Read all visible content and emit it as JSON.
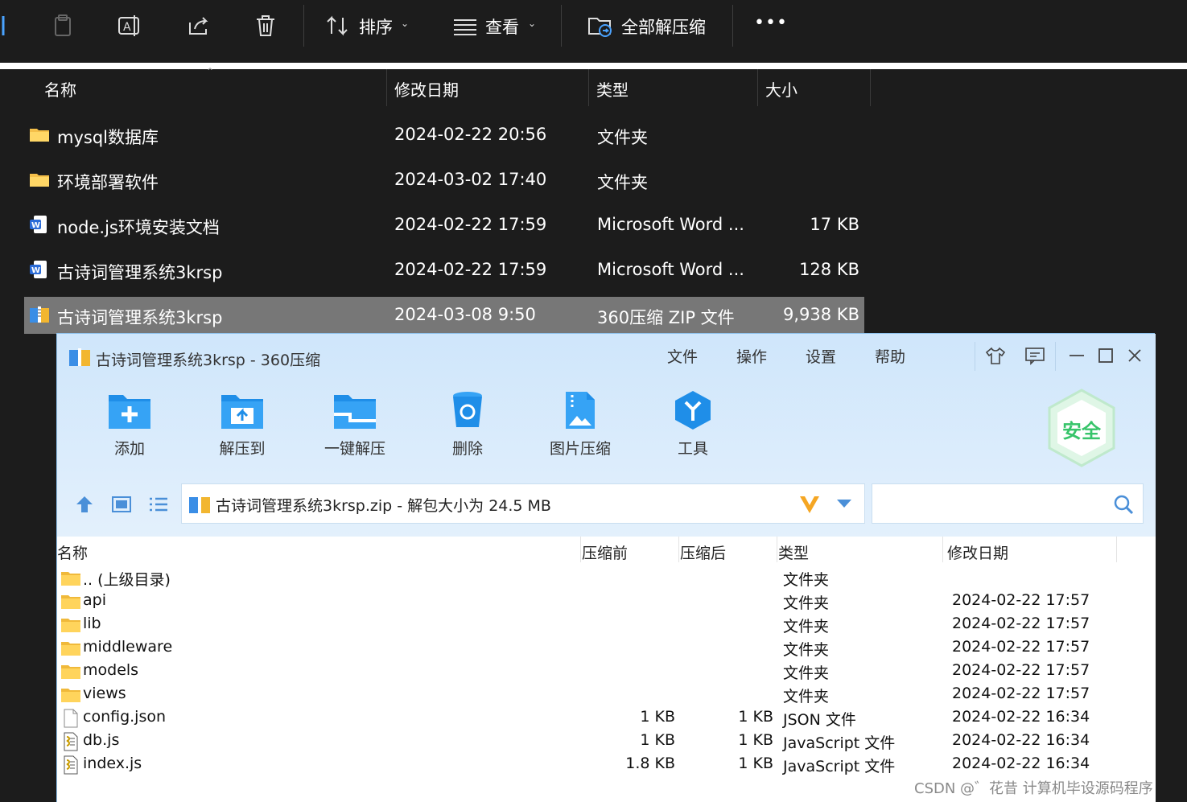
{
  "toolbar": {
    "sort_label": "排序",
    "view_label": "查看",
    "extract_all_label": "全部解压缩",
    "more_label": "•••"
  },
  "explorer": {
    "columns": {
      "name": "名称",
      "modified": "修改日期",
      "type": "类型",
      "size": "大小"
    },
    "rows": [
      {
        "name": "mysql数据库",
        "modified": "2024-02-22 20:56",
        "type": "文件夹",
        "size": "",
        "icon": "folder-icon"
      },
      {
        "name": "环境部署软件",
        "modified": "2024-03-02 17:40",
        "type": "文件夹",
        "size": "",
        "icon": "folder-icon"
      },
      {
        "name": "node.js环境安装文档",
        "modified": "2024-02-22 17:59",
        "type": "Microsoft Word ...",
        "size": "17 KB",
        "icon": "word-doc-icon"
      },
      {
        "name": "古诗词管理系统3krsp",
        "modified": "2024-02-22 17:59",
        "type": "Microsoft Word ...",
        "size": "128 KB",
        "icon": "word-doc-icon"
      },
      {
        "name": "古诗词管理系统3krsp",
        "modified": "2024-03-08 9:50",
        "type": "360压缩 ZIP 文件",
        "size": "9,938 KB",
        "icon": "zip-archive-icon",
        "selected": true
      }
    ]
  },
  "zip": {
    "title": "古诗词管理系统3krsp - 360压缩",
    "menu": {
      "file": "文件",
      "operate": "操作",
      "settings": "设置",
      "help": "帮助"
    },
    "tools": {
      "add": "添加",
      "extract_to": "解压到",
      "one_click": "一键解压",
      "delete": "删除",
      "image_compress": "图片压缩",
      "tools": "工具"
    },
    "security_badge": "安全",
    "address": "古诗词管理系统3krsp.zip - 解包大小为 24.5 MB",
    "columns": {
      "name": "名称",
      "before": "压缩前",
      "after": "压缩后",
      "type": "类型",
      "modified": "修改日期"
    },
    "rows": [
      {
        "name": ".. (上级目录)",
        "before": "",
        "after": "",
        "type": "文件夹",
        "modified": "",
        "icon": "folder-icon"
      },
      {
        "name": "api",
        "before": "",
        "after": "",
        "type": "文件夹",
        "modified": "2024-02-22 17:57",
        "icon": "folder-icon"
      },
      {
        "name": "lib",
        "before": "",
        "after": "",
        "type": "文件夹",
        "modified": "2024-02-22 17:57",
        "icon": "folder-icon"
      },
      {
        "name": "middleware",
        "before": "",
        "after": "",
        "type": "文件夹",
        "modified": "2024-02-22 17:57",
        "icon": "folder-icon"
      },
      {
        "name": "models",
        "before": "",
        "after": "",
        "type": "文件夹",
        "modified": "2024-02-22 17:57",
        "icon": "folder-icon"
      },
      {
        "name": "views",
        "before": "",
        "after": "",
        "type": "文件夹",
        "modified": "2024-02-22 17:57",
        "icon": "folder-icon"
      },
      {
        "name": "config.json",
        "before": "1 KB",
        "after": "1 KB",
        "type": "JSON 文件",
        "modified": "2024-02-22 16:34",
        "icon": "file-icon"
      },
      {
        "name": "db.js",
        "before": "1 KB",
        "after": "1 KB",
        "type": "JavaScript 文件",
        "modified": "2024-02-22 16:34",
        "icon": "script-file-icon"
      },
      {
        "name": "index.js",
        "before": "1.8 KB",
        "after": "1 KB",
        "type": "JavaScript 文件",
        "modified": "2024-02-22 16:34",
        "icon": "script-file-icon"
      }
    ]
  },
  "watermark": "CSDN @゛花昔  计算机毕设源码程序"
}
